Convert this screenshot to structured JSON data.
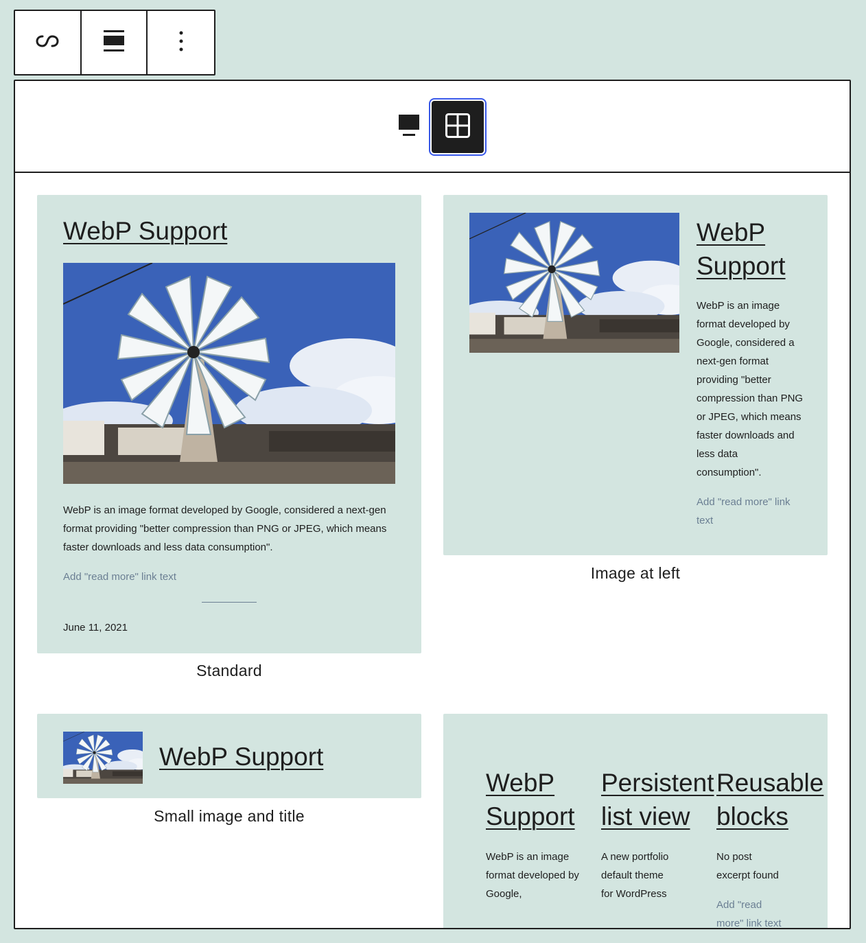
{
  "toolbar": {
    "items": [
      {
        "name": "link-icon"
      },
      {
        "name": "align-wide-icon"
      },
      {
        "name": "more-vertical-icon"
      }
    ]
  },
  "view_switcher": {
    "desktop_icon": "desktop-icon",
    "grid_icon": "grid-icon",
    "active": "grid"
  },
  "patterns": {
    "standard": {
      "title": "WebP Support",
      "excerpt": "WebP is an image format developed by Google, considered a next-gen format providing \"better compression than PNG or JPEG, which means faster downloads and less data consumption\".",
      "read_more": "Add \"read more\" link text",
      "date": "June 11, 2021",
      "caption": "Standard"
    },
    "image_left": {
      "title": "WebP Support",
      "excerpt": "WebP is an image format developed by Google, considered a next-gen format providing \"better compression than PNG or JPEG, which means faster downloads and less data consumption\".",
      "read_more": "Add \"read more\" link text",
      "caption": "Image at left"
    },
    "small_image": {
      "title": "WebP Support",
      "caption": "Small image and title"
    },
    "grid": {
      "posts": [
        {
          "title": "WebP Support",
          "excerpt": "WebP is an image format developed by Google,"
        },
        {
          "title": "Persistent list view",
          "excerpt": "A new portfolio default theme for WordPress"
        },
        {
          "title": "Reusable blocks",
          "excerpt": "No post excerpt found",
          "read_more": "Add \"read more\" link text"
        }
      ]
    }
  },
  "colors": {
    "background": "#d3e5e0",
    "ink": "#1e1e1e",
    "focus": "#3858e9",
    "muted_link": "#6b7f93",
    "sky": "#3a62b8"
  }
}
